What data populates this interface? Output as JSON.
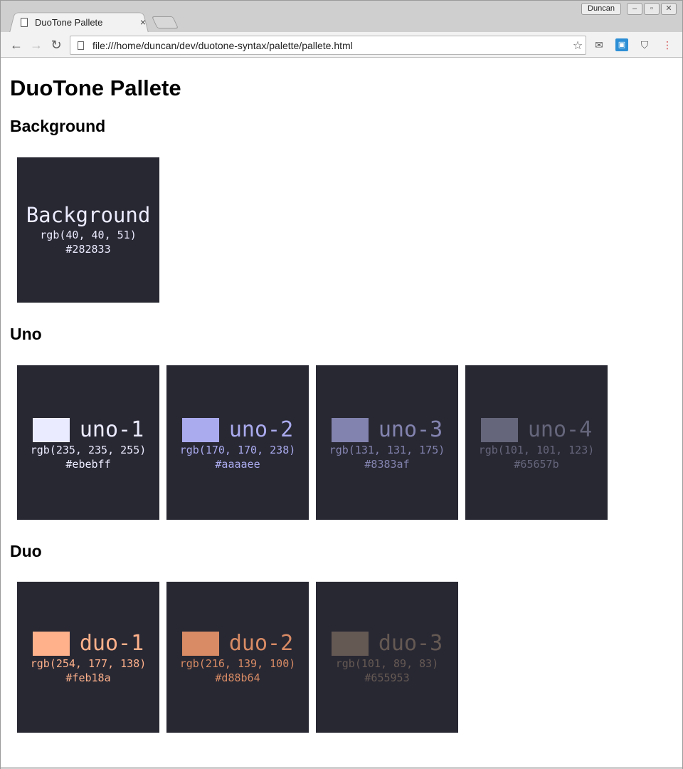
{
  "browser": {
    "tab_title": "DuoTone Pallete",
    "tab_close": "×",
    "profile_name": "Duncan",
    "window_controls": {
      "minimize": "–",
      "maximize": "▫",
      "close": "✕"
    },
    "url": "file:///home/duncan/dev/duotone-syntax/palette/pallete.html",
    "nav": {
      "back": "←",
      "forward": "→",
      "reload": "↻",
      "star": "☆",
      "menu": "⋮"
    }
  },
  "page": {
    "title": "DuoTone Pallete",
    "sections": {
      "background": {
        "heading": "Background",
        "swatches": [
          {
            "name": "Background",
            "rgb": "rgb(40, 40, 51)",
            "hex": "#282833",
            "color": "#282833"
          }
        ]
      },
      "uno": {
        "heading": "Uno",
        "swatches": [
          {
            "name": "uno-1",
            "rgb": "rgb(235, 235, 255)",
            "hex": "#ebebff",
            "color": "#ebebff"
          },
          {
            "name": "uno-2",
            "rgb": "rgb(170, 170, 238)",
            "hex": "#aaaaee",
            "color": "#aaaaee"
          },
          {
            "name": "uno-3",
            "rgb": "rgb(131, 131, 175)",
            "hex": "#8383af",
            "color": "#8383af"
          },
          {
            "name": "uno-4",
            "rgb": "rgb(101, 101, 123)",
            "hex": "#65657b",
            "color": "#65657b"
          }
        ]
      },
      "duo": {
        "heading": "Duo",
        "swatches": [
          {
            "name": "duo-1",
            "rgb": "rgb(254, 177, 138)",
            "hex": "#feb18a",
            "color": "#feb18a"
          },
          {
            "name": "duo-2",
            "rgb": "rgb(216, 139, 100)",
            "hex": "#d88b64",
            "color": "#d88b64"
          },
          {
            "name": "duo-3",
            "rgb": "rgb(101, 89, 83)",
            "hex": "#655953",
            "color": "#655953"
          }
        ]
      }
    }
  }
}
